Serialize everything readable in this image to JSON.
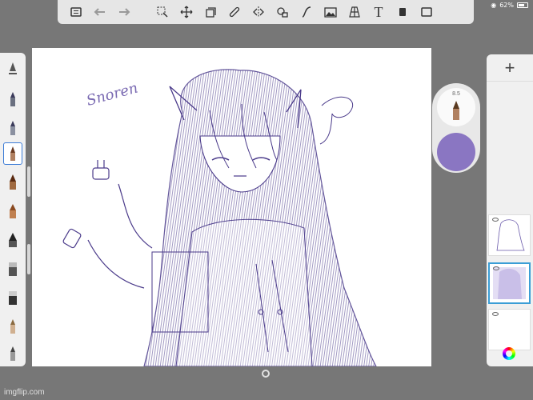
{
  "status": {
    "battery_text": "62%"
  },
  "toolbar": {
    "tools": [
      "gallery-icon",
      "undo-icon",
      "redo-icon",
      "selection-icon",
      "transform-icon",
      "layers-icon",
      "ruler-icon",
      "symmetry-icon",
      "fill-icon",
      "curve-icon",
      "image-icon",
      "perspective-icon",
      "text-icon",
      "fullscreen-icon",
      "window-icon"
    ],
    "text_tool_label": "T"
  },
  "puck": {
    "size_label": "8.5",
    "color": "#8a76c2"
  },
  "layers": {
    "add_label": "+",
    "count": 3,
    "selected_index": 1
  },
  "canvas": {
    "ink_color": "#4a3a8a",
    "signature_text": "Snoren"
  },
  "accent": "#3b7bd6",
  "watermark": "imgflip.com"
}
